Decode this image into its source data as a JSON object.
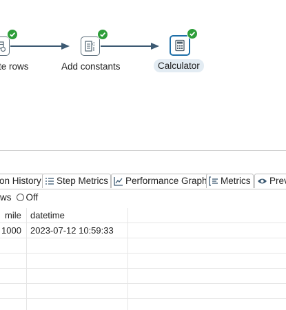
{
  "graph": {
    "steps": [
      {
        "label": "te rows",
        "icon": "table-rows-icon",
        "status": "ok"
      },
      {
        "label": "Add constants",
        "icon": "add-constants-icon",
        "status": "ok"
      },
      {
        "label": "Calculator",
        "icon": "calculator-icon",
        "status": "ok",
        "selected": true
      }
    ]
  },
  "tabs": [
    {
      "label": "on History",
      "icon": "history-icon"
    },
    {
      "label": "Step Metrics",
      "icon": "step-metrics-icon"
    },
    {
      "label": "Performance Graph",
      "icon": "performance-graph-icon"
    },
    {
      "label": "Metrics",
      "icon": "metrics-icon"
    },
    {
      "label": "Prev",
      "icon": "eye-icon"
    }
  ],
  "options": {
    "rows_label": "ws",
    "off_label": "Off"
  },
  "table": {
    "columns": [
      "mile",
      "datetime"
    ],
    "rows": [
      [
        "1000",
        "2023-07-12 10:59:33"
      ]
    ]
  },
  "colors": {
    "ok": "#2e9e3a",
    "hop": "#3d5a73",
    "selected_border": "#1f6fa8"
  }
}
